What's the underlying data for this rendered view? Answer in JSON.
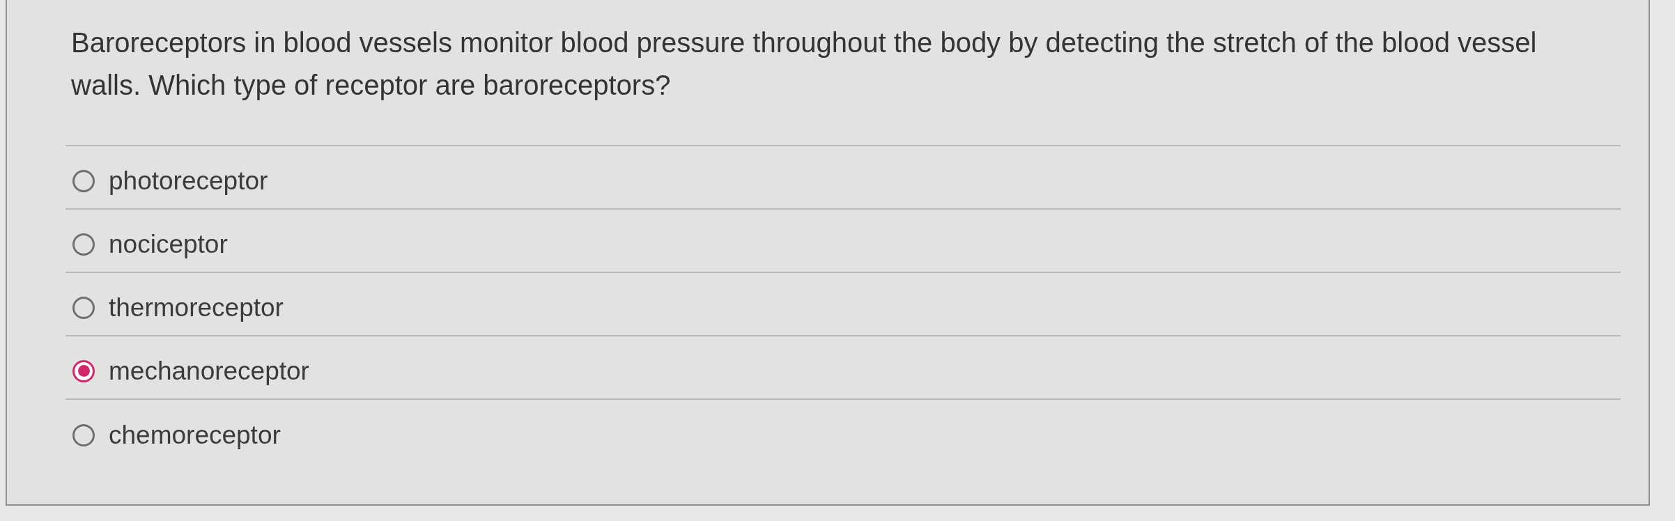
{
  "question": "Baroreceptors in blood vessels monitor blood pressure throughout the body by detecting the stretch of the blood vessel walls. Which type of receptor are baroreceptors?",
  "options": [
    {
      "label": "photoreceptor",
      "selected": false
    },
    {
      "label": "nociceptor",
      "selected": false
    },
    {
      "label": "thermoreceptor",
      "selected": false
    },
    {
      "label": "mechanoreceptor",
      "selected": true
    },
    {
      "label": "chemoreceptor",
      "selected": false
    }
  ]
}
